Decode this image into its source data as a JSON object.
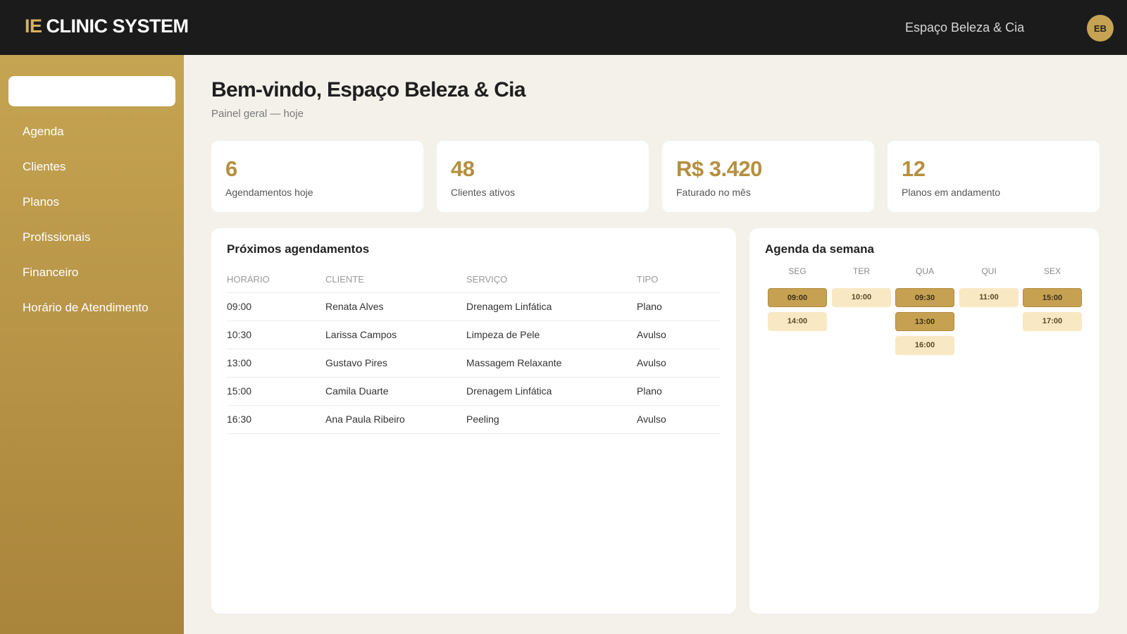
{
  "header": {
    "brand_mark": "IE",
    "brand_text": "CLINIC SYSTEM",
    "clinic_name": "Espaço Beleza & Cia",
    "avatar_initials": "EB"
  },
  "sidebar": {
    "search_value": "",
    "items": [
      {
        "label": "Agenda"
      },
      {
        "label": "Clientes"
      },
      {
        "label": "Planos"
      },
      {
        "label": "Profissionais"
      },
      {
        "label": "Financeiro"
      },
      {
        "label": "Horário de Atendimento"
      }
    ]
  },
  "main": {
    "welcome": "Bem-vindo, Espaço Beleza & Cia",
    "subtitle": "Painel geral — hoje"
  },
  "stats": [
    {
      "value": "6",
      "label": "Agendamentos hoje"
    },
    {
      "value": "48",
      "label": "Clientes ativos"
    },
    {
      "value": "R$ 3.420",
      "label": "Faturado no mês"
    },
    {
      "value": "12",
      "label": "Planos em andamento"
    }
  ],
  "appointments": {
    "title": "Próximos agendamentos",
    "columns": [
      "HORÁRIO",
      "CLIENTE",
      "SERVIÇO",
      "TIPO"
    ],
    "rows": [
      {
        "time": "09:00",
        "client": "Renata Alves",
        "service": "Drenagem Linfática",
        "type": "Plano"
      },
      {
        "time": "10:30",
        "client": "Larissa Campos",
        "service": "Limpeza de Pele",
        "type": "Avulso"
      },
      {
        "time": "13:00",
        "client": "Gustavo Pires",
        "service": "Massagem Relaxante",
        "type": "Avulso"
      },
      {
        "time": "15:00",
        "client": "Camila Duarte",
        "service": "Drenagem Linfática",
        "type": "Plano"
      },
      {
        "time": "16:30",
        "client": "Ana Paula Ribeiro",
        "service": "Peeling",
        "type": "Avulso"
      }
    ]
  },
  "week": {
    "title": "Agenda da semana",
    "days": [
      {
        "label": "SEG",
        "slots": [
          {
            "time": "09:00",
            "style": "dark"
          },
          {
            "time": "14:00",
            "style": "light"
          }
        ]
      },
      {
        "label": "TER",
        "slots": [
          {
            "time": "10:00",
            "style": "light"
          }
        ]
      },
      {
        "label": "QUA",
        "slots": [
          {
            "time": "09:30",
            "style": "dark"
          },
          {
            "time": "13:00",
            "style": "dark"
          },
          {
            "time": "16:00",
            "style": "light"
          }
        ]
      },
      {
        "label": "QUI",
        "slots": [
          {
            "time": "11:00",
            "style": "light"
          }
        ]
      },
      {
        "label": "SEX",
        "slots": [
          {
            "time": "15:00",
            "style": "dark"
          },
          {
            "time": "17:00",
            "style": "light"
          }
        ]
      }
    ]
  },
  "colors": {
    "accent": "#c6a353",
    "topbar": "#1b1b1c",
    "background": "#f4f1eb",
    "slot_dark": "#c7a152",
    "slot_light": "#f8e8c4"
  }
}
